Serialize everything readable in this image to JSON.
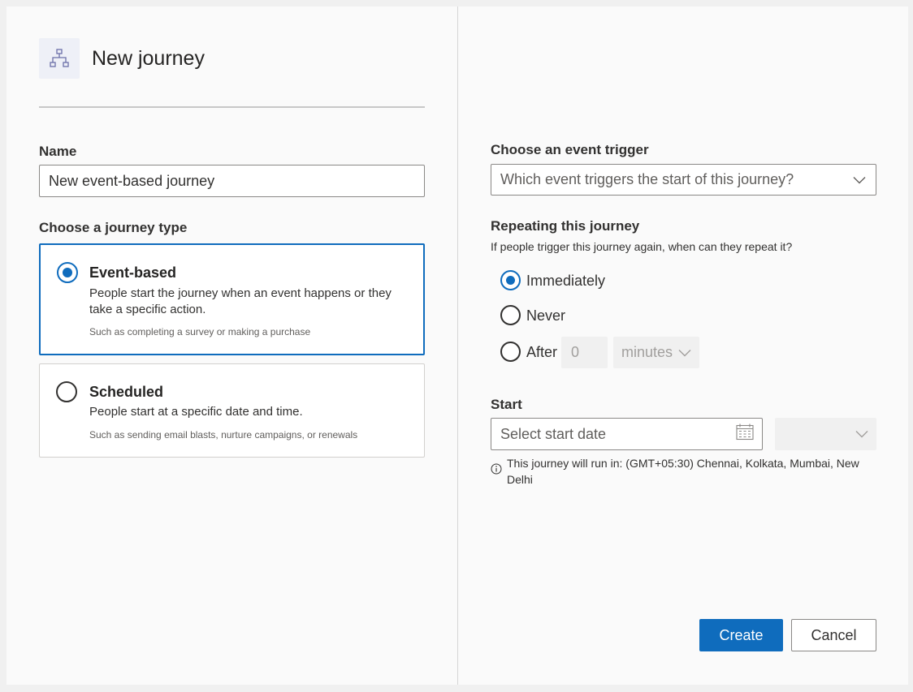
{
  "header": {
    "title": "New journey",
    "icon": "org-chart-icon"
  },
  "name_field": {
    "label": "Name",
    "value": "New event-based journey"
  },
  "journey_type": {
    "label": "Choose a journey type",
    "options": [
      {
        "title": "Event-based",
        "description": "People start the journey when an event happens or they take a specific action.",
        "example": "Such as completing a survey or making a purchase",
        "selected": true
      },
      {
        "title": "Scheduled",
        "description": "People start at a specific date and time.",
        "example": "Such as sending email blasts, nurture campaigns, or renewals",
        "selected": false
      }
    ]
  },
  "event_trigger": {
    "label": "Choose an event trigger",
    "placeholder": "Which event triggers the start of this journey?"
  },
  "repeating": {
    "label": "Repeating this journey",
    "description": "If people trigger this journey again, when can they repeat it?",
    "options": [
      {
        "label": "Immediately",
        "selected": true
      },
      {
        "label": "Never",
        "selected": false
      },
      {
        "label": "After",
        "selected": false
      }
    ],
    "after_value": "0",
    "after_unit": "minutes"
  },
  "start": {
    "label": "Start",
    "date_placeholder": "Select start date",
    "time_value": "",
    "timezone_note": "This journey will run in: (GMT+05:30) Chennai, Kolkata, Mumbai, New Delhi"
  },
  "actions": {
    "create_label": "Create",
    "cancel_label": "Cancel"
  },
  "colors": {
    "accent": "#0f6cbd"
  }
}
